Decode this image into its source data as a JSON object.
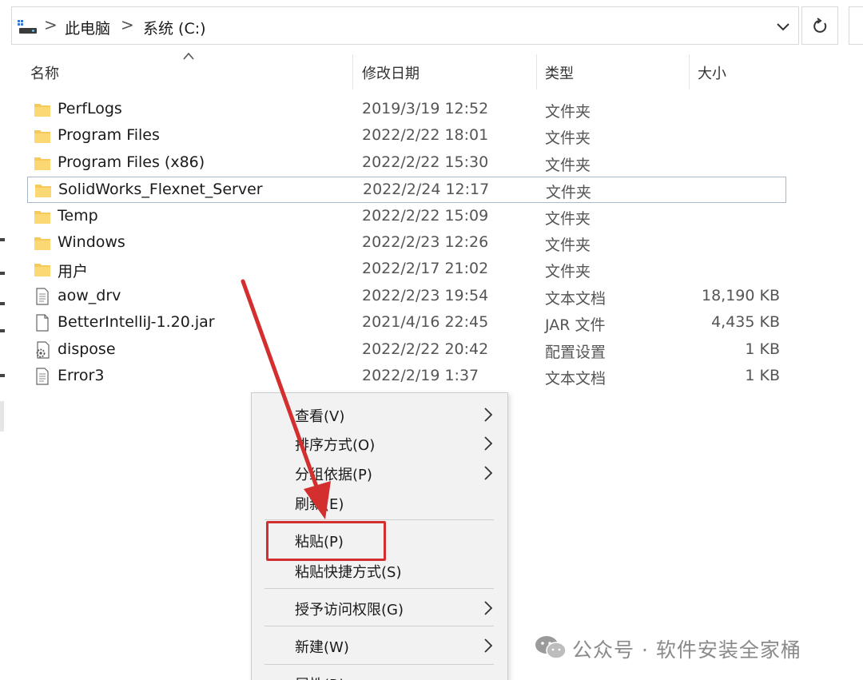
{
  "address_bar": {
    "crumbs": [
      "此电脑",
      "系统 (C:)"
    ],
    "separator": ">",
    "dropdown_icon": "chevron-down-icon",
    "refresh_icon": "refresh-icon"
  },
  "columns": {
    "name": "名称",
    "modified": "修改日期",
    "type": "类型",
    "size": "大小"
  },
  "files": [
    {
      "name": "PerfLogs",
      "modified": "2019/3/19 12:52",
      "type": "文件夹",
      "size": "",
      "icon": "folder-icon"
    },
    {
      "name": "Program Files",
      "modified": "2022/2/22 18:01",
      "type": "文件夹",
      "size": "",
      "icon": "folder-icon"
    },
    {
      "name": "Program Files (x86)",
      "modified": "2022/2/22 15:30",
      "type": "文件夹",
      "size": "",
      "icon": "folder-icon"
    },
    {
      "name": "SolidWorks_Flexnet_Server",
      "modified": "2022/2/24 12:17",
      "type": "文件夹",
      "size": "",
      "icon": "folder-icon",
      "selected": true
    },
    {
      "name": "Temp",
      "modified": "2022/2/22 15:09",
      "type": "文件夹",
      "size": "",
      "icon": "folder-icon"
    },
    {
      "name": "Windows",
      "modified": "2022/2/23 12:26",
      "type": "文件夹",
      "size": "",
      "icon": "folder-icon"
    },
    {
      "name": "用户",
      "modified": "2022/2/17 21:02",
      "type": "文件夹",
      "size": "",
      "icon": "folder-icon"
    },
    {
      "name": "aow_drv",
      "modified": "2022/2/23 19:54",
      "type": "文本文档",
      "size": "18,190 KB",
      "icon": "text-file-icon"
    },
    {
      "name": "BetterIntelliJ-1.20.jar",
      "modified": "2021/4/16 22:45",
      "type": "JAR 文件",
      "size": "4,435 KB",
      "icon": "file-icon"
    },
    {
      "name": "dispose",
      "modified": "2022/2/22 20:42",
      "type": "配置设置",
      "size": "1 KB",
      "icon": "config-file-icon"
    },
    {
      "name": "Error3",
      "modified": "2022/2/19 1:37",
      "type": "文本文档",
      "size": "1 KB",
      "icon": "text-file-icon"
    }
  ],
  "context_menu": {
    "items": [
      {
        "label": "查看(V)",
        "submenu": true
      },
      {
        "label": "排序方式(O)",
        "submenu": true
      },
      {
        "label": "分组依据(P)",
        "submenu": true
      },
      {
        "label": "刷新(E)",
        "submenu": false
      },
      {
        "label": "粘贴(P)",
        "submenu": false,
        "highlighted": true
      },
      {
        "label": "粘贴快捷方式(S)",
        "submenu": false
      },
      {
        "label": "授予访问权限(G)",
        "submenu": true
      },
      {
        "label": "新建(W)",
        "submenu": true
      },
      {
        "label": "属性(R)",
        "submenu": false
      }
    ]
  },
  "annotation": {
    "color": "#d32f2f"
  },
  "watermark": {
    "text": "公众号 · 软件安装全家桶",
    "icon": "wechat-logo-icon"
  },
  "colors": {
    "folder": "#f6c95a",
    "selection_border": "#a9b9c9",
    "annotation": "#d32f2f"
  }
}
